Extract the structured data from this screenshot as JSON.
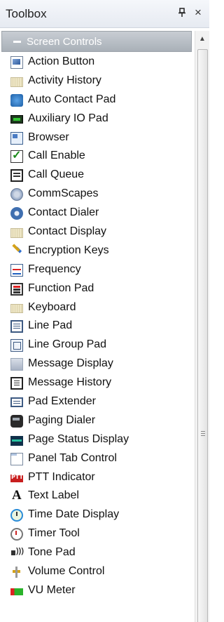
{
  "window": {
    "title": "Toolbox",
    "pin_glyph": "⊥",
    "close_glyph": "×"
  },
  "group": {
    "label": "Screen Controls",
    "expanded": true
  },
  "items": [
    {
      "label": "Action Button",
      "icon": "action-button-icon"
    },
    {
      "label": "Activity History",
      "icon": "activity-history-icon"
    },
    {
      "label": "Auto Contact Pad",
      "icon": "auto-contact-pad-icon"
    },
    {
      "label": "Auxiliary IO Pad",
      "icon": "auxiliary-io-pad-icon"
    },
    {
      "label": "Browser",
      "icon": "browser-icon"
    },
    {
      "label": "Call Enable",
      "icon": "checkmark-icon"
    },
    {
      "label": "Call Queue",
      "icon": "call-queue-icon"
    },
    {
      "label": "CommScapes",
      "icon": "commscapes-icon"
    },
    {
      "label": "Contact Dialer",
      "icon": "gear-icon"
    },
    {
      "label": "Contact Display",
      "icon": "contact-display-icon"
    },
    {
      "label": "Encryption Keys",
      "icon": "keys-icon"
    },
    {
      "label": "Frequency",
      "icon": "frequency-icon"
    },
    {
      "label": "Function Pad",
      "icon": "function-pad-icon"
    },
    {
      "label": "Keyboard",
      "icon": "keyboard-icon"
    },
    {
      "label": "Line Pad",
      "icon": "line-pad-icon"
    },
    {
      "label": "Line Group Pad",
      "icon": "line-group-pad-icon"
    },
    {
      "label": "Message Display",
      "icon": "message-display-icon"
    },
    {
      "label": "Message History",
      "icon": "message-history-icon"
    },
    {
      "label": "Pad Extender",
      "icon": "pad-extender-icon"
    },
    {
      "label": "Paging Dialer",
      "icon": "paging-dialer-icon"
    },
    {
      "label": "Page Status Display",
      "icon": "page-status-display-icon"
    },
    {
      "label": "Panel Tab Control",
      "icon": "panel-tab-control-icon"
    },
    {
      "label": "PTT Indicator",
      "icon": "ptt-indicator-icon"
    },
    {
      "label": "Text Label",
      "icon": "text-label-icon"
    },
    {
      "label": "Time Date Display",
      "icon": "clock-icon"
    },
    {
      "label": "Timer Tool",
      "icon": "timer-icon"
    },
    {
      "label": "Tone Pad",
      "icon": "speaker-icon"
    },
    {
      "label": "Volume Control",
      "icon": "volume-slider-icon"
    },
    {
      "label": "VU Meter",
      "icon": "vu-meter-icon"
    }
  ],
  "scrollbar": {
    "up_glyph": "▲"
  }
}
